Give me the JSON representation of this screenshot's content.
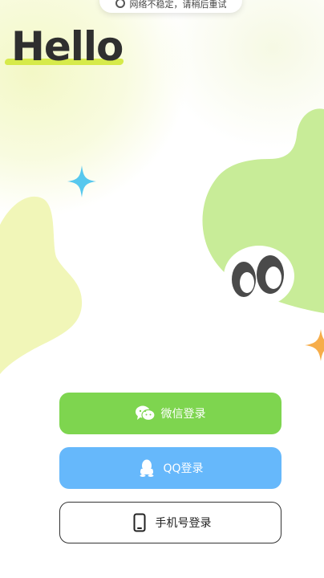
{
  "toast": {
    "text": "网络不稳定，请稍后重试",
    "icon": "gear-icon"
  },
  "greeting": "Hello",
  "buttons": {
    "wechat_label": "微信登录",
    "qq_label": "QQ登录",
    "phone_label": "手机号登录"
  },
  "colors": {
    "wechat": "#7ed54f",
    "qq": "#66b8fb",
    "accent_yellow": "#d6ea4a",
    "blob_green": "#c8ec98",
    "blob_yellow": "#f1f6b8",
    "sparkle_blue": "#57c8ee",
    "sparkle_orange": "#f6ad4a"
  },
  "icons": {
    "wechat": "wechat-icon",
    "qq": "qq-penguin-icon",
    "phone": "phone-icon"
  }
}
